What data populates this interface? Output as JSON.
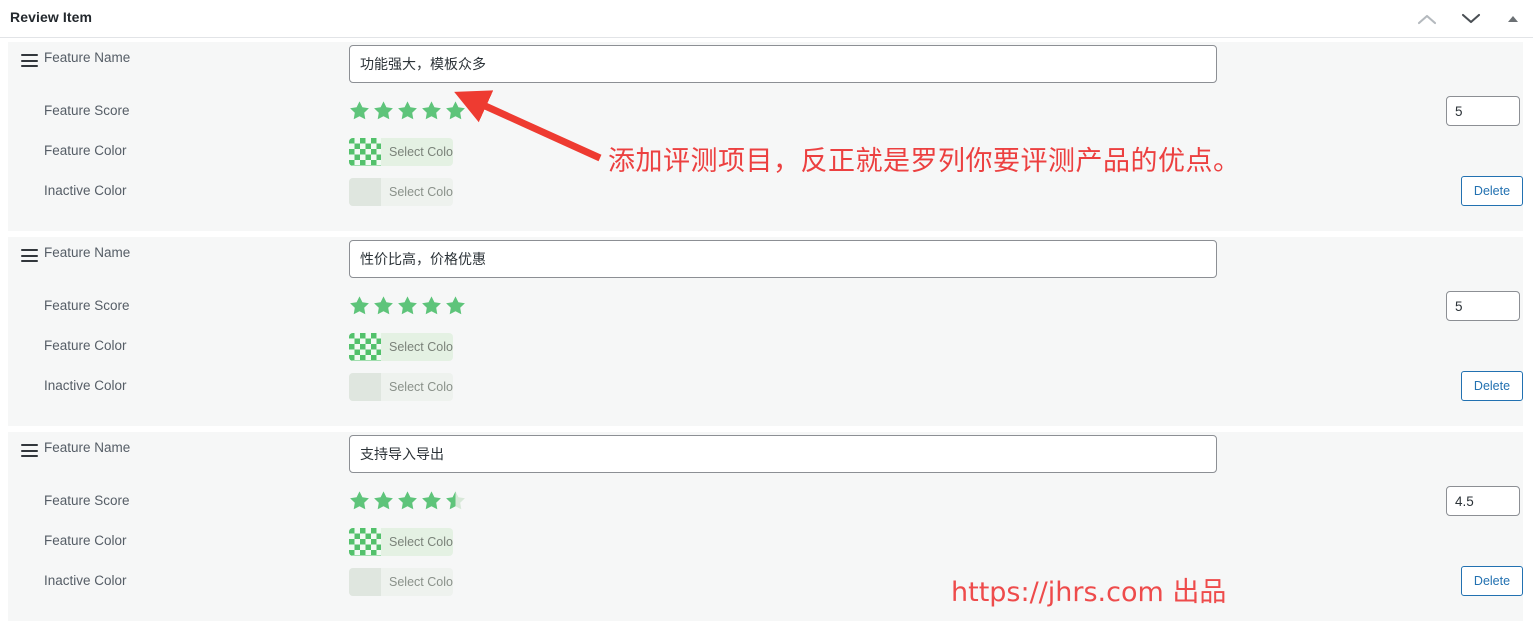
{
  "header": {
    "title": "Review Item",
    "order_up_icon": "chevron-up-icon",
    "order_down_icon": "chevron-down-icon",
    "toggle_icon": "triangle-up-icon"
  },
  "labels": {
    "feature_name": "Feature Name",
    "feature_score": "Feature Score",
    "feature_color": "Feature Color",
    "inactive_color": "Inactive Color",
    "select_color": "Select Color",
    "delete": "Delete",
    "drag_handle_icon": "drag-handle-icon",
    "star_icon": "star-icon"
  },
  "colors": {
    "star_active": "#5ec47a",
    "star_inactive": "#d7e8d8",
    "swatch_green": "#52c16b",
    "swatch_inactive": "#dfe6df",
    "button_blue": "#2271b1",
    "annotation_red": "#ec4040",
    "panel_bg": "#f6f7f7"
  },
  "items": [
    {
      "name_value": "功能强大，模板众多",
      "score_value": "5",
      "stars": 5,
      "feature_color_label": "Select Color",
      "inactive_color_label": "Select Color",
      "delete_label": "Delete"
    },
    {
      "name_value": "性价比高，价格优惠",
      "score_value": "5",
      "stars": 5,
      "feature_color_label": "Select Color",
      "inactive_color_label": "Select Color",
      "delete_label": "Delete"
    },
    {
      "name_value": "支持导入导出",
      "score_value": "4.5",
      "stars": 4.5,
      "feature_color_label": "Select Color",
      "inactive_color_label": "Select Color",
      "delete_label": "Delete"
    }
  ],
  "annotations": {
    "arrow_note": "添加评测项目，反正就是罗列你要评测产品的优点。",
    "watermark": "https://jhrs.com  出品"
  }
}
